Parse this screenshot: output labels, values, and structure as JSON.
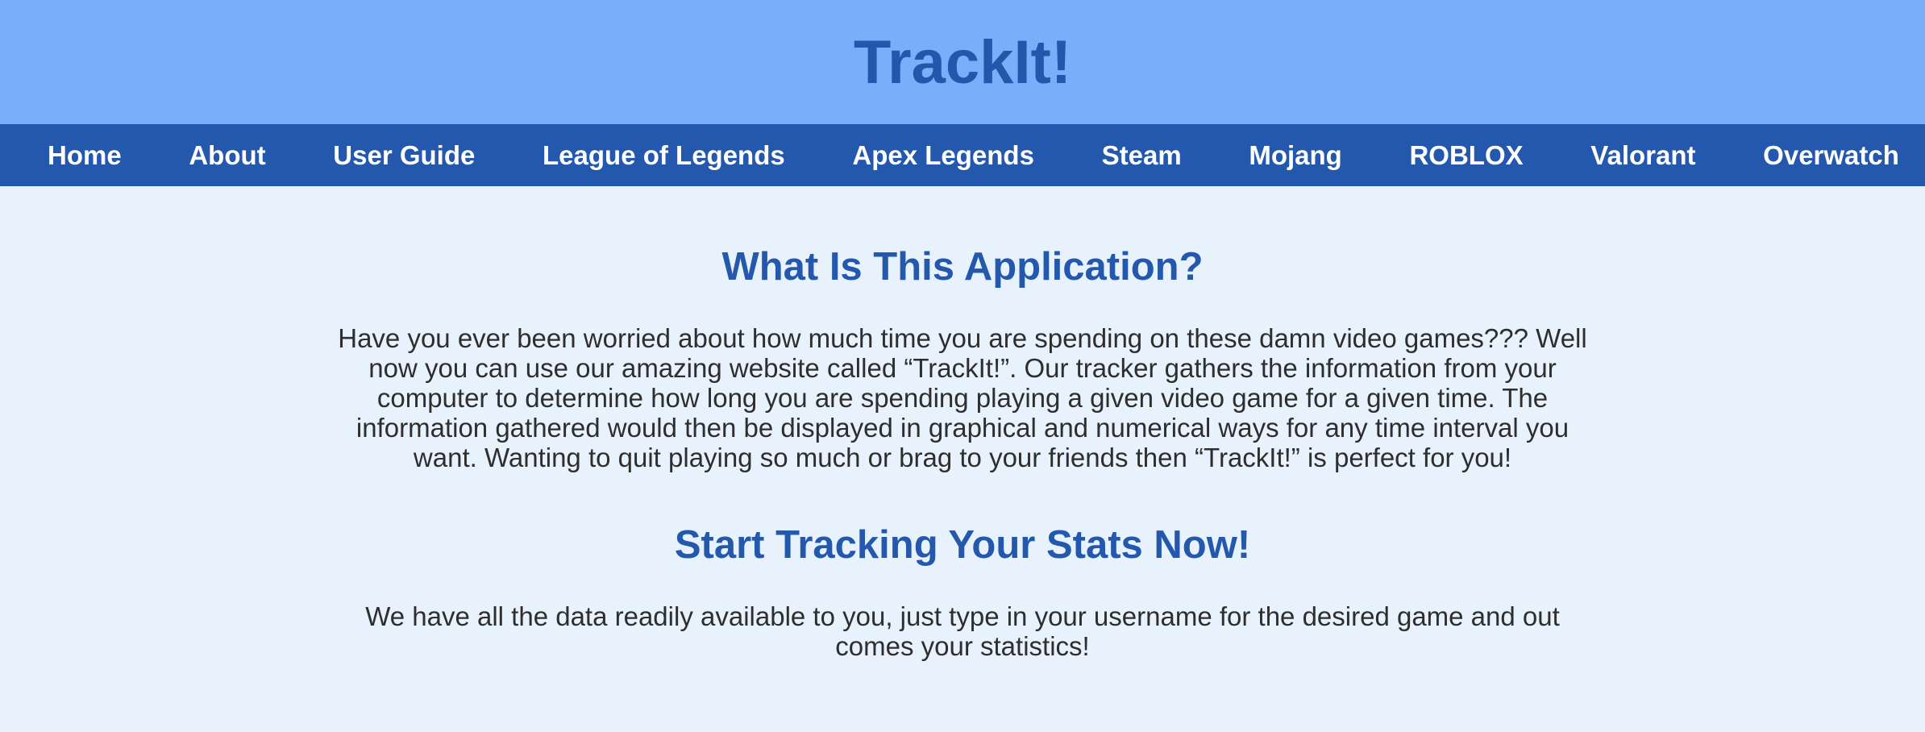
{
  "header": {
    "title": "TrackIt!"
  },
  "nav": {
    "items": [
      {
        "label": "Home"
      },
      {
        "label": "About"
      },
      {
        "label": "User Guide"
      },
      {
        "label": "League of Legends"
      },
      {
        "label": "Apex Legends"
      },
      {
        "label": "Steam"
      },
      {
        "label": "Mojang"
      },
      {
        "label": "ROBLOX"
      },
      {
        "label": "Valorant"
      },
      {
        "label": "Overwatch"
      }
    ]
  },
  "main": {
    "sections": [
      {
        "heading": "What Is This Application?",
        "text": "Have you ever been worried about how much time you are spending on these damn video games??? Well now you can use our amazing website called “TrackIt!”. Our tracker gathers the information from your computer to determine how long you are spending playing a given video game for a given time. The information gathered would then be displayed in graphical and numerical ways for any time interval you want. Wanting to quit playing so much or brag to your friends then “TrackIt!” is perfect for you!"
      },
      {
        "heading": "Start Tracking Your Stats Now!",
        "text": "We have all the data readily available to you, just type in your username for the desired game and out comes your statistics!"
      }
    ]
  },
  "colors": {
    "header_bg": "#78aefa",
    "nav_bg": "#2458ad",
    "page_bg": "#e8f2fd",
    "heading": "#2458ad",
    "body_text": "#2e2e2e"
  }
}
